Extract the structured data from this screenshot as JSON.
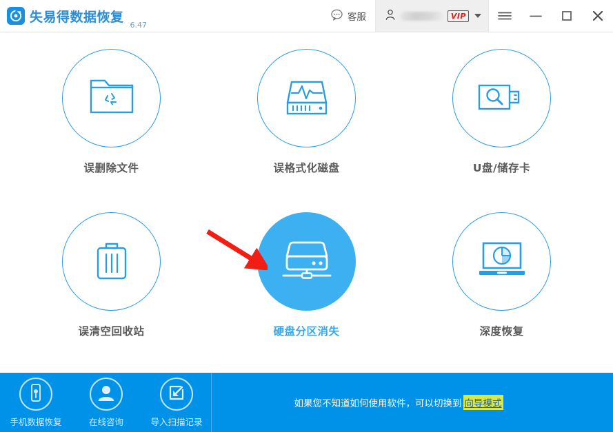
{
  "titlebar": {
    "logo_icon": "refresh-circle-logo",
    "app_title": "失易得数据恢复",
    "version": "6.47",
    "support_label": "客服",
    "support_icon": "speech-bubble-icon",
    "user_icon": "person-icon",
    "user_name": "",
    "vip_badge": "VIP",
    "caret_icon": "chevron-down-icon",
    "menu_icon": "hamburger-menu-icon",
    "minimize_icon": "minimize-icon",
    "maximize_icon": "maximize-icon",
    "close_icon": "close-icon"
  },
  "modes": [
    {
      "id": "deleted-files",
      "label": "误删除文件",
      "icon": "folder-recycle-icon",
      "selected": false
    },
    {
      "id": "formatted-disk",
      "label": "误格式化磁盘",
      "icon": "disk-pulse-icon",
      "selected": false
    },
    {
      "id": "usb-memory-card",
      "label": "U盘/储存卡",
      "icon": "usb-search-icon",
      "selected": false
    },
    {
      "id": "emptied-recycle",
      "label": "误清空回收站",
      "icon": "trash-can-icon",
      "selected": false
    },
    {
      "id": "lost-partition",
      "label": "硬盘分区消失",
      "icon": "network-drive-icon",
      "selected": true
    },
    {
      "id": "deep-recovery",
      "label": "深度恢复",
      "icon": "laptop-pie-icon",
      "selected": false
    }
  ],
  "bottombar": {
    "items": [
      {
        "id": "phone-recovery",
        "label": "手机数据恢复",
        "icon": "mobile-phone-icon"
      },
      {
        "id": "online-support",
        "label": "在线咨询",
        "icon": "person-support-icon"
      },
      {
        "id": "import-scan-log",
        "label": "导入扫描记录",
        "icon": "import-arrow-icon"
      }
    ],
    "hint_text": "如果您不知道如何使用软件，可以切换到",
    "wizard_link": "向导模式"
  },
  "annotation": {
    "arrow_icon": "red-arrow-annotation"
  },
  "colors": {
    "accent_blue": "#2a9ce0",
    "selected_blue": "#3cb0f0",
    "bottombar_blue": "#0092e8",
    "title_blue": "#2b8ed6",
    "vip_red": "#e02020",
    "label_grey": "#5a5a5a",
    "arrow_red": "#f01e14",
    "wizard_highlight": "#d8e84a"
  }
}
